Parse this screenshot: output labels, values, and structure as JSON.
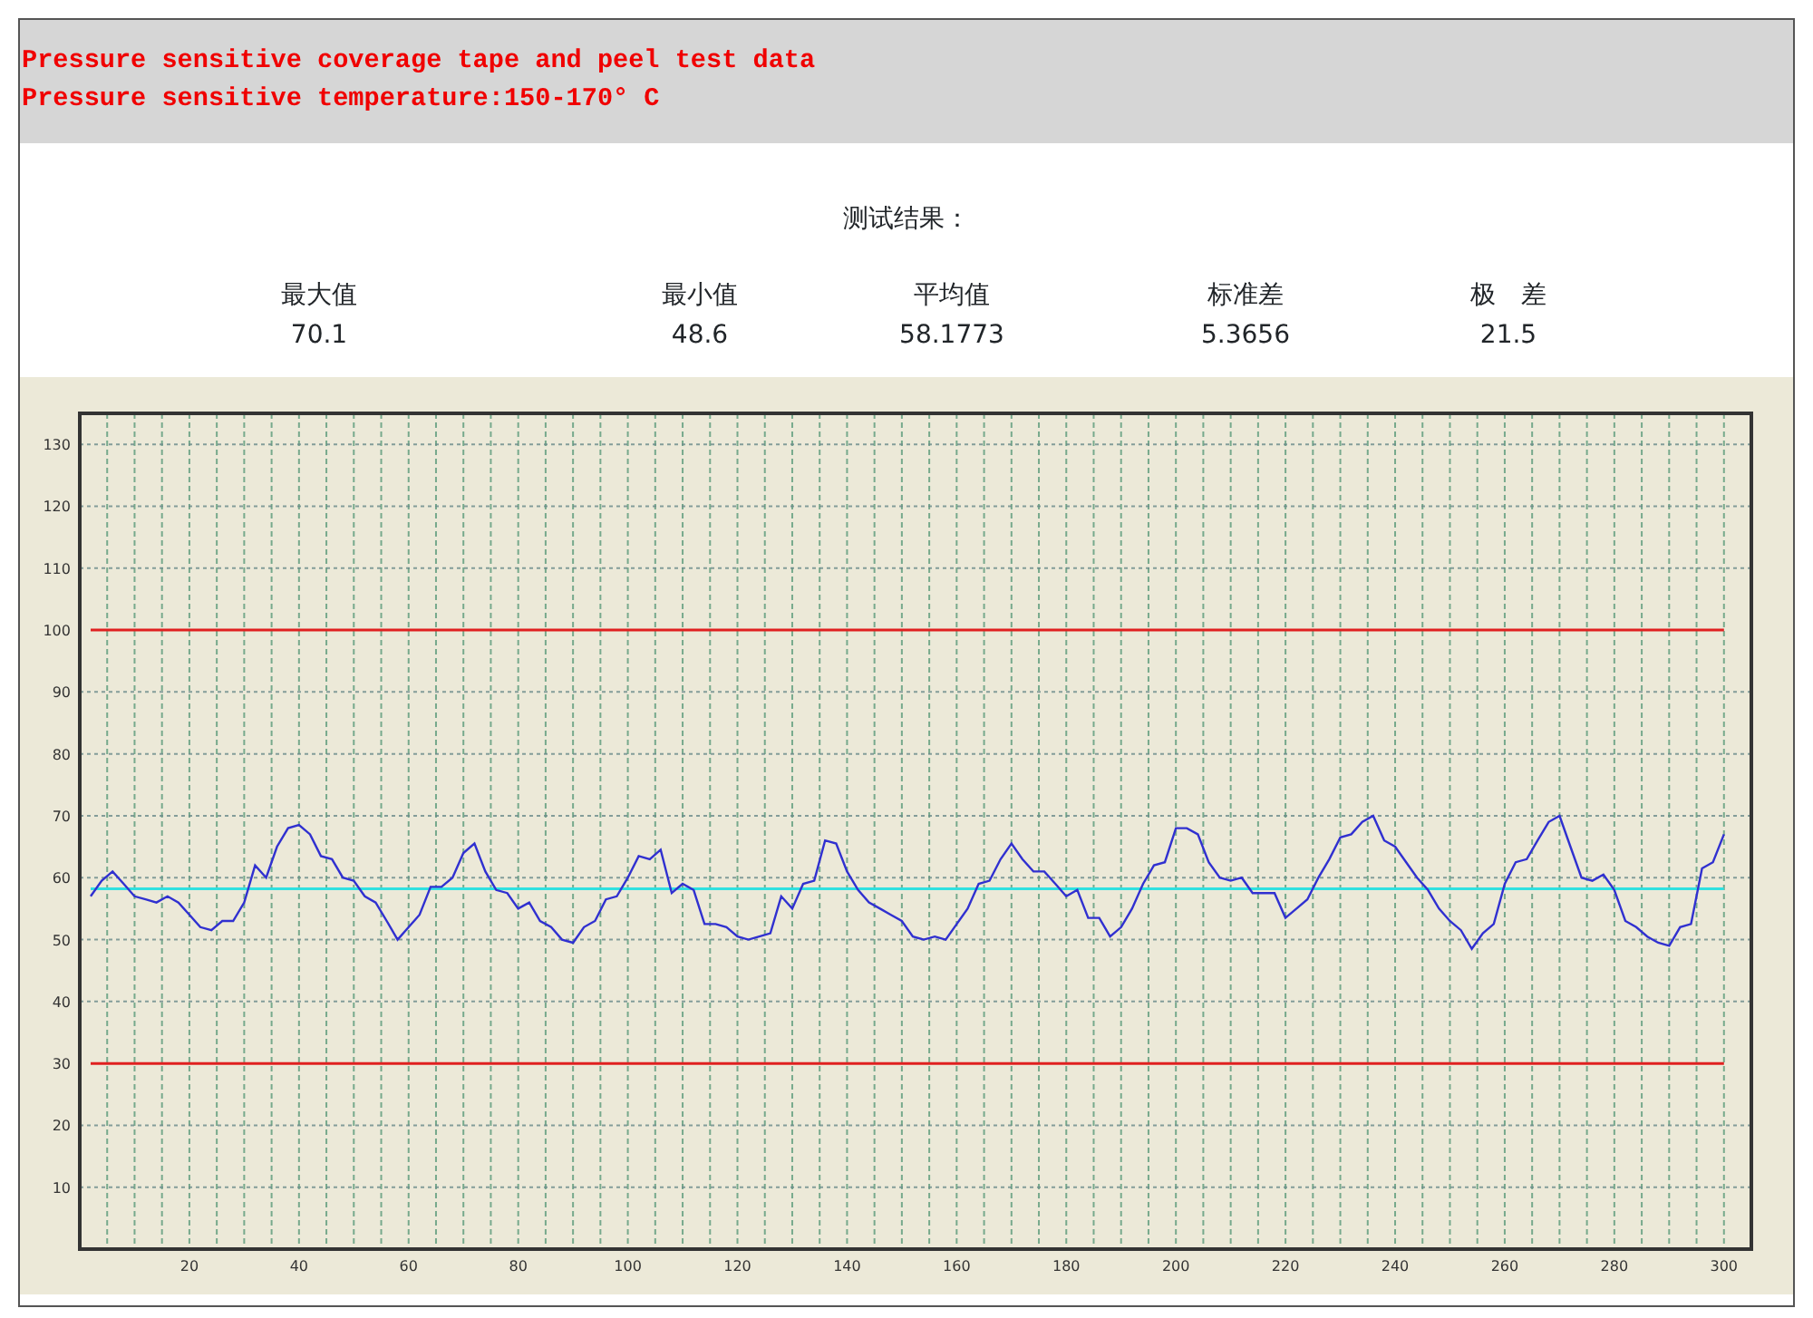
{
  "header": {
    "lines": [
      "Pressure sensitive coverage tape and peel test data",
      "Pressure sensitive temperature:150-170° C"
    ]
  },
  "results": {
    "title": "测试结果：",
    "stats": [
      {
        "label": "最大值",
        "value": "70.1"
      },
      {
        "label": "最小值",
        "value": "48.6"
      },
      {
        "label": "平均值",
        "value": "58.1773"
      },
      {
        "label": "标准差",
        "value": "5.3656"
      },
      {
        "label": "极　差",
        "value": "21.5"
      }
    ]
  },
  "chart": {
    "chart_data": {
      "type": "line",
      "xlim": [
        0,
        305
      ],
      "ylim": [
        0,
        135
      ],
      "xticks": [
        20,
        40,
        60,
        80,
        100,
        120,
        140,
        160,
        180,
        200,
        220,
        240,
        260,
        280,
        300
      ],
      "yticks": [
        10,
        20,
        30,
        40,
        50,
        60,
        70,
        80,
        90,
        100,
        110,
        120,
        130
      ],
      "x": [
        2,
        4,
        6,
        8,
        10,
        12,
        14,
        16,
        18,
        20,
        22,
        24,
        26,
        28,
        30,
        32,
        34,
        36,
        38,
        40,
        42,
        44,
        46,
        48,
        50,
        52,
        54,
        56,
        58,
        60,
        62,
        64,
        66,
        68,
        70,
        72,
        74,
        76,
        78,
        80,
        82,
        84,
        86,
        88,
        90,
        92,
        94,
        96,
        98,
        100,
        102,
        104,
        106,
        108,
        110,
        112,
        114,
        116,
        118,
        120,
        122,
        124,
        126,
        128,
        130,
        132,
        134,
        136,
        138,
        140,
        142,
        144,
        146,
        148,
        150,
        152,
        154,
        156,
        158,
        160,
        162,
        164,
        166,
        168,
        170,
        172,
        174,
        176,
        178,
        180,
        182,
        184,
        186,
        188,
        190,
        192,
        194,
        196,
        198,
        200,
        202,
        204,
        206,
        208,
        210,
        212,
        214,
        216,
        218,
        220,
        222,
        224,
        226,
        228,
        230,
        232,
        234,
        236,
        238,
        240,
        242,
        244,
        246,
        248,
        250,
        252,
        254,
        256,
        258,
        260,
        262,
        264,
        266,
        268,
        270,
        272,
        274,
        276,
        278,
        280,
        282,
        284,
        286,
        288,
        290,
        292,
        294,
        296,
        298,
        300
      ],
      "series": [
        {
          "color": "#e02020",
          "values": [
            100,
            100,
            100,
            100,
            100,
            100,
            100,
            100,
            100,
            100,
            100,
            100,
            100,
            100,
            100,
            100,
            100,
            100,
            100,
            100,
            100,
            100,
            100,
            100,
            100,
            100,
            100,
            100,
            100,
            100,
            100,
            100,
            100,
            100,
            100,
            100,
            100,
            100,
            100,
            100,
            100,
            100,
            100,
            100,
            100,
            100,
            100,
            100,
            100,
            100,
            100,
            100,
            100,
            100,
            100,
            100,
            100,
            100,
            100,
            100,
            100,
            100,
            100,
            100,
            100,
            100,
            100,
            100,
            100,
            100,
            100,
            100,
            100,
            100,
            100,
            100,
            100,
            100,
            100,
            100,
            100,
            100,
            100,
            100,
            100,
            100,
            100,
            100,
            100,
            100,
            100,
            100,
            100,
            100,
            100,
            100,
            100,
            100,
            100,
            100,
            100,
            100,
            100,
            100,
            100,
            100,
            100,
            100,
            100,
            100,
            100,
            100,
            100,
            100,
            100,
            100,
            100,
            100,
            100,
            100,
            100,
            100,
            100,
            100,
            100,
            100,
            100,
            100,
            100,
            100,
            100,
            100,
            100,
            100,
            100,
            100,
            100,
            100,
            100,
            100,
            100,
            100,
            100,
            100,
            100,
            100,
            100,
            100,
            100,
            100
          ]
        },
        {
          "color": "#e02020",
          "values": [
            30,
            30,
            30,
            30,
            30,
            30,
            30,
            30,
            30,
            30,
            30,
            30,
            30,
            30,
            30,
            30,
            30,
            30,
            30,
            30,
            30,
            30,
            30,
            30,
            30,
            30,
            30,
            30,
            30,
            30,
            30,
            30,
            30,
            30,
            30,
            30,
            30,
            30,
            30,
            30,
            30,
            30,
            30,
            30,
            30,
            30,
            30,
            30,
            30,
            30,
            30,
            30,
            30,
            30,
            30,
            30,
            30,
            30,
            30,
            30,
            30,
            30,
            30,
            30,
            30,
            30,
            30,
            30,
            30,
            30,
            30,
            30,
            30,
            30,
            30,
            30,
            30,
            30,
            30,
            30,
            30,
            30,
            30,
            30,
            30,
            30,
            30,
            30,
            30,
            30,
            30,
            30,
            30,
            30,
            30,
            30,
            30,
            30,
            30,
            30,
            30,
            30,
            30,
            30,
            30,
            30,
            30,
            30,
            30,
            30,
            30,
            30,
            30,
            30,
            30,
            30,
            30,
            30,
            30,
            30,
            30,
            30,
            30,
            30,
            30,
            30,
            30,
            30,
            30,
            30,
            30,
            30,
            30,
            30,
            30,
            30,
            30,
            30,
            30,
            30,
            30,
            30,
            30,
            30,
            30,
            30,
            30,
            30,
            30,
            30
          ]
        },
        {
          "color": "#30e0e0",
          "values": [
            58.18,
            58.18,
            58.18,
            58.18,
            58.18,
            58.18,
            58.18,
            58.18,
            58.18,
            58.18,
            58.18,
            58.18,
            58.18,
            58.18,
            58.18,
            58.18,
            58.18,
            58.18,
            58.18,
            58.18,
            58.18,
            58.18,
            58.18,
            58.18,
            58.18,
            58.18,
            58.18,
            58.18,
            58.18,
            58.18,
            58.18,
            58.18,
            58.18,
            58.18,
            58.18,
            58.18,
            58.18,
            58.18,
            58.18,
            58.18,
            58.18,
            58.18,
            58.18,
            58.18,
            58.18,
            58.18,
            58.18,
            58.18,
            58.18,
            58.18,
            58.18,
            58.18,
            58.18,
            58.18,
            58.18,
            58.18,
            58.18,
            58.18,
            58.18,
            58.18,
            58.18,
            58.18,
            58.18,
            58.18,
            58.18,
            58.18,
            58.18,
            58.18,
            58.18,
            58.18,
            58.18,
            58.18,
            58.18,
            58.18,
            58.18,
            58.18,
            58.18,
            58.18,
            58.18,
            58.18,
            58.18,
            58.18,
            58.18,
            58.18,
            58.18,
            58.18,
            58.18,
            58.18,
            58.18,
            58.18,
            58.18,
            58.18,
            58.18,
            58.18,
            58.18,
            58.18,
            58.18,
            58.18,
            58.18,
            58.18,
            58.18,
            58.18,
            58.18,
            58.18,
            58.18,
            58.18,
            58.18,
            58.18,
            58.18,
            58.18,
            58.18,
            58.18,
            58.18,
            58.18,
            58.18,
            58.18,
            58.18,
            58.18,
            58.18,
            58.18,
            58.18,
            58.18,
            58.18,
            58.18,
            58.18,
            58.18,
            58.18,
            58.18,
            58.18,
            58.18,
            58.18,
            58.18,
            58.18,
            58.18,
            58.18,
            58.18,
            58.18,
            58.18,
            58.18,
            58.18,
            58.18,
            58.18,
            58.18,
            58.18,
            58.18,
            58.18,
            58.18,
            58.18,
            58.18,
            58.18
          ]
        },
        {
          "color": "#3030d0",
          "values": [
            57,
            59.5,
            61,
            59,
            57,
            56.5,
            56,
            57,
            56,
            54,
            52,
            51.5,
            53,
            53,
            56,
            62,
            60,
            65,
            68,
            68.5,
            67,
            63.5,
            63,
            60,
            59.5,
            57,
            56,
            53,
            50,
            52,
            54,
            58.5,
            58.5,
            60,
            64,
            65.5,
            61,
            58,
            57.5,
            55,
            56,
            53,
            52,
            50,
            49.5,
            52,
            53,
            56.5,
            57,
            60,
            63.5,
            63,
            64.5,
            57.5,
            59,
            58,
            52.5,
            52.5,
            52,
            50.5,
            50,
            50.5,
            51,
            57,
            55,
            59,
            59.5,
            66,
            65.5,
            61,
            58,
            56,
            55,
            54,
            53,
            50.5,
            50,
            50.5,
            50,
            52.5,
            55,
            59,
            59.5,
            63,
            65.5,
            63,
            61,
            61,
            59,
            57,
            58,
            53.5,
            53.5,
            50.5,
            52,
            55,
            59,
            62,
            62.5,
            68,
            68,
            67,
            62.5,
            60,
            59.5,
            60,
            57.5,
            57.5,
            57.5,
            53.5,
            55,
            56.5,
            60,
            63,
            66.5,
            67,
            69,
            70,
            66,
            65,
            62.5,
            60,
            58,
            55,
            53,
            51.5,
            48.5,
            51,
            52.5,
            59,
            62.5,
            63,
            66,
            69,
            70,
            65,
            60,
            59.5,
            60.5,
            58,
            53,
            52,
            50.5,
            49.5,
            49,
            52,
            52.5,
            61.5,
            62.5,
            67
          ]
        }
      ],
      "grid": true
    }
  }
}
